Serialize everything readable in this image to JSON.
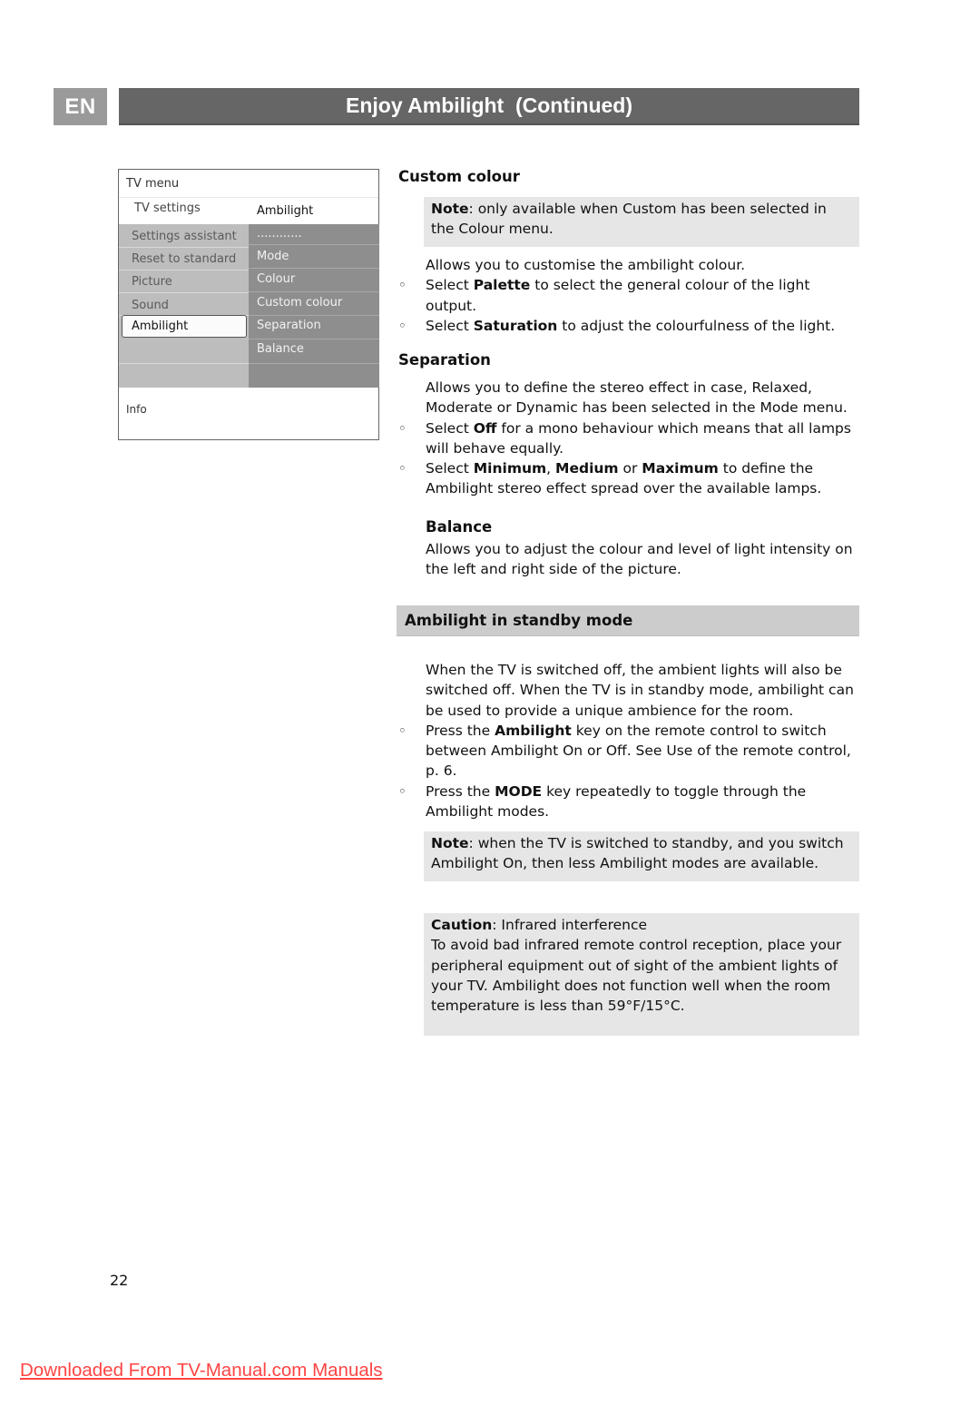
{
  "header": {
    "language": "EN",
    "title": "Enjoy Ambilight  (Continued)"
  },
  "tv_menu": {
    "title": "TV menu",
    "breadcrumb_left": "TV settings",
    "breadcrumb_right": "Ambilight",
    "left_items": [
      "Settings assistant",
      "Reset to standard",
      "Picture",
      "Sound",
      "Ambilight"
    ],
    "selected_item": "Ambilight",
    "right_items": [
      "............",
      "Mode",
      "Colour",
      "Custom colour",
      "Separation",
      "Balance"
    ],
    "info_label": "Info"
  },
  "custom_colour": {
    "heading": "Custom colour",
    "note_label": "Note",
    "note_text": ": only available when Custom has been selected in the Colour menu.",
    "intro": "Allows you to customise the ambilight colour.",
    "bullets": [
      {
        "pre": "Select ",
        "bold": "Palette",
        "post": " to select the general colour of the light output."
      },
      {
        "pre": "Select ",
        "bold": "Saturation",
        "post": " to adjust the colourfulness of the light."
      }
    ]
  },
  "separation": {
    "heading": "Separation",
    "intro": "Allows you to define the stereo effect in case, Relaxed, Moderate or Dynamic has been selected in the Mode menu.",
    "bullet1": {
      "pre": "Select ",
      "bold": "Off",
      "post": " for a mono behaviour which means that all lamps will behave equally."
    },
    "bullet2": {
      "pre": "Select ",
      "bold1": "Minimum",
      "mid1": ", ",
      "bold2": "Medium",
      "mid2": " or ",
      "bold3": "Maximum",
      "post": " to define the Ambilight stereo effect spread over the available lamps."
    }
  },
  "balance": {
    "heading": "Balance",
    "text": "Allows you to adjust the colour and level of light intensity on the left and right side of the picture."
  },
  "standby": {
    "heading": "Ambilight in standby mode",
    "intro": "When the TV is switched off, the ambient lights will also be switched off. When the TV is in standby mode, ambilight can be used to provide a unique ambience for the room.",
    "bullets": [
      {
        "pre": "Press the ",
        "bold": "Ambilight",
        "post": " key on the remote control to switch between Ambilight On or Off. See Use of the remote control, p. 6."
      },
      {
        "pre": "Press the ",
        "bold": "MODE",
        "post": " key repeatedly to toggle through the Ambilight modes."
      }
    ],
    "note_label": "Note",
    "note_text": ": when the TV is switched to standby, and you switch Ambilight On, then less Ambilight modes are available."
  },
  "caution": {
    "label": "Caution",
    "subtitle": ": Infrared interference",
    "text": "To avoid bad infrared remote control reception, place your peripheral equipment out of sight of the ambient lights of your TV. Ambilight does not  function well when the room temperature is less than 59°F/15°C."
  },
  "page_number": "22",
  "footer_link": "Downloaded From TV-Manual.com Manuals",
  "colors": {
    "title_bar": "#666666",
    "lang_badge": "#9a9a9a",
    "note_bg": "#e6e6e6",
    "section_bar": "#cccccc",
    "footer_link": "#ff4444"
  }
}
